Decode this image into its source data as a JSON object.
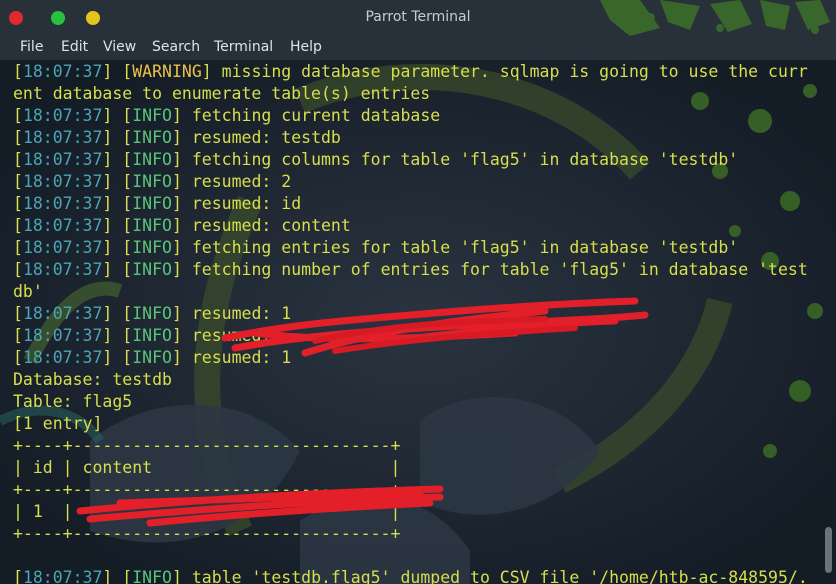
{
  "window": {
    "title": "Parrot Terminal",
    "controls": [
      "close",
      "minimize",
      "maximize"
    ],
    "control_colors": {
      "close": "#e0282d",
      "minimize": "#27c23f",
      "maximize": "#e3c51c"
    }
  },
  "menu": [
    "File",
    "Edit",
    "View",
    "Search",
    "Terminal",
    "Help"
  ],
  "terminal": {
    "log_lines": [
      {
        "time": "18:07:37",
        "level": "WARNING",
        "text": "missing database parameter. sqlmap is going to use the curr"
      },
      {
        "continuation": "ent database to enumerate table(s) entries"
      },
      {
        "time": "18:07:37",
        "level": "INFO",
        "text": "fetching current database"
      },
      {
        "time": "18:07:37",
        "level": "INFO",
        "text": "resumed: testdb"
      },
      {
        "time": "18:07:37",
        "level": "INFO",
        "text": "fetching columns for table 'flag5' in database 'testdb'"
      },
      {
        "time": "18:07:37",
        "level": "INFO",
        "text": "resumed: 2"
      },
      {
        "time": "18:07:37",
        "level": "INFO",
        "text": "resumed: id"
      },
      {
        "time": "18:07:37",
        "level": "INFO",
        "text": "resumed: content"
      },
      {
        "time": "18:07:37",
        "level": "INFO",
        "text": "fetching entries for table 'flag5' in database 'testdb'"
      },
      {
        "time": "18:07:37",
        "level": "INFO",
        "text": "fetching number of entries for table 'flag5' in database 'test"
      },
      {
        "continuation": "db'"
      },
      {
        "time": "18:07:37",
        "level": "INFO",
        "text": "resumed: 1"
      },
      {
        "time": "18:07:37",
        "level": "INFO",
        "text": "resumed: "
      },
      {
        "time": "18:07:37",
        "level": "INFO",
        "text": "resumed: 1"
      },
      {
        "plain": "Database: testdb"
      },
      {
        "plain": "Table: flag5"
      },
      {
        "plain": "[1 entry]"
      },
      {
        "plain": "+----+--------------------------------+"
      },
      {
        "plain": "| id | content                        |"
      },
      {
        "plain": "+----+--------------------------------+"
      },
      {
        "plain": "| 1  |                                |"
      },
      {
        "plain": "+----+--------------------------------+"
      },
      {
        "plain": ""
      },
      {
        "time": "18:07:37",
        "level": "INFO",
        "text": "table 'testdb.flag5' dumped to CSV file '/home/htb-ac-848595/."
      }
    ],
    "colors": {
      "timestamp": "#4aa5b5",
      "bracket": "#d9df52",
      "info": "#58c57a",
      "warning": "#e9c14a",
      "message": "#d6df4d",
      "redaction": "#e3202a"
    }
  }
}
